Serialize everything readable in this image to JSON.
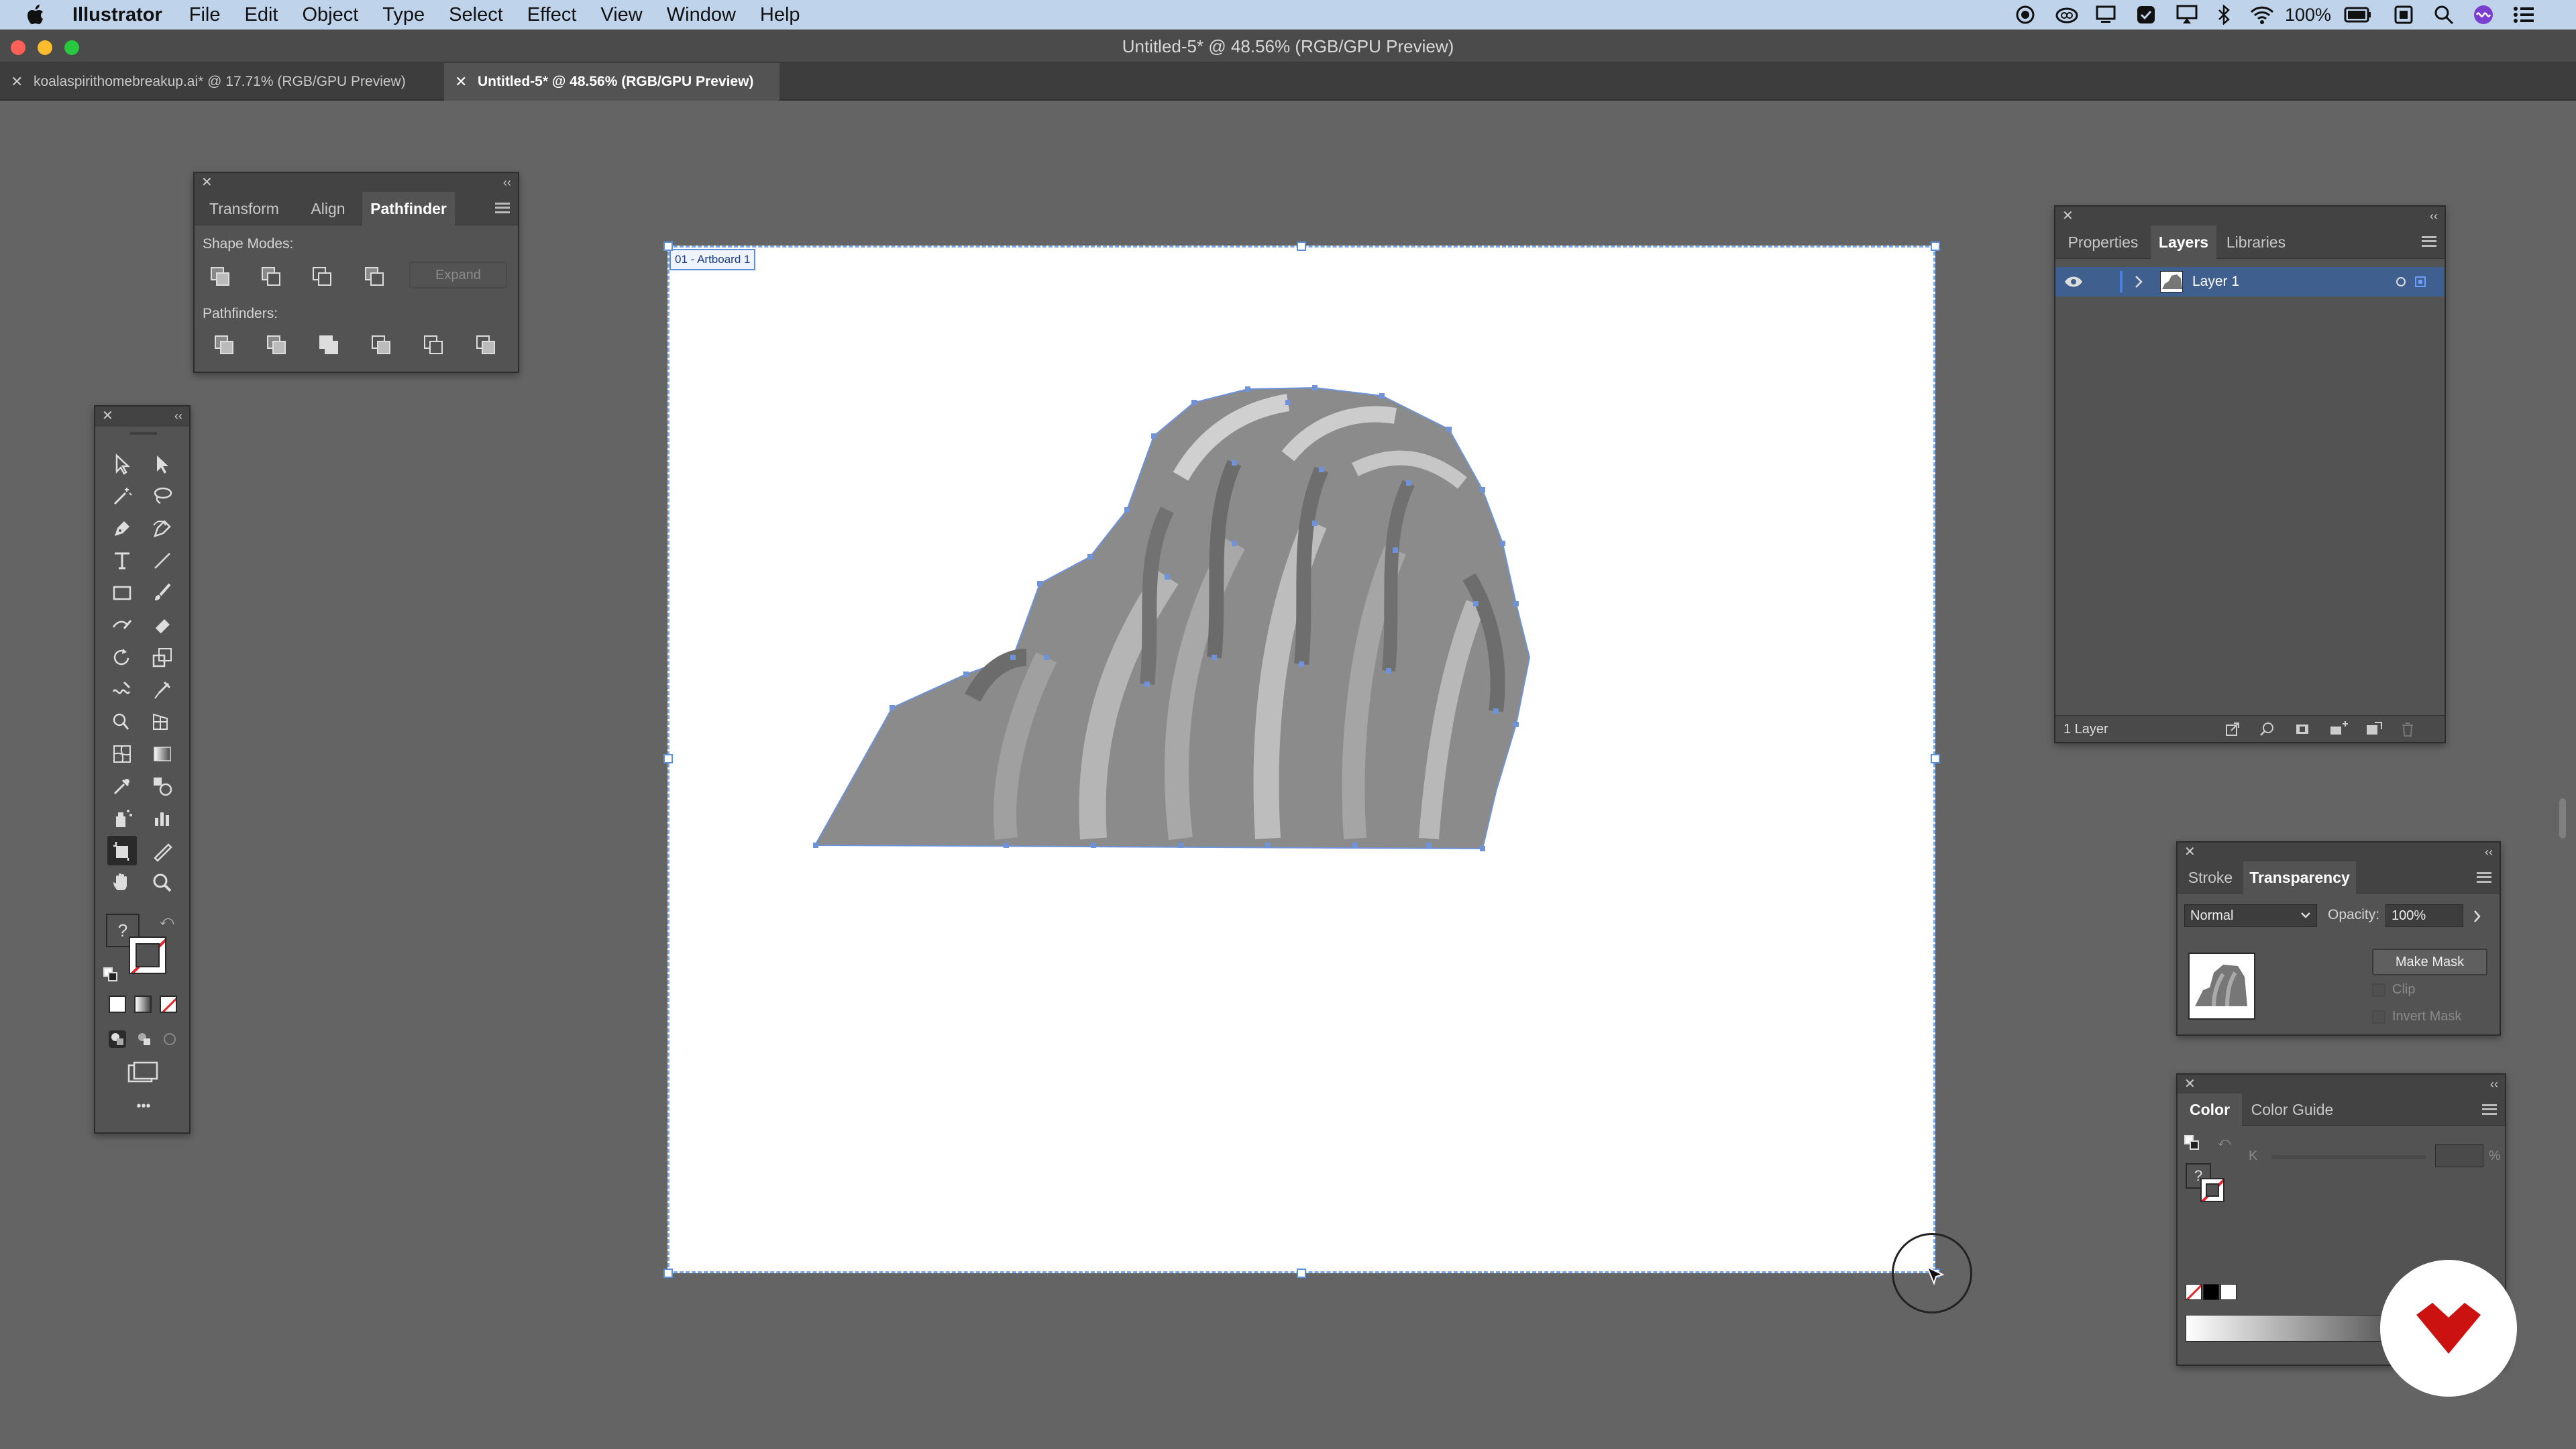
{
  "menubar": {
    "app": "Illustrator",
    "items": [
      "File",
      "Edit",
      "Object",
      "Type",
      "Select",
      "Effect",
      "View",
      "Window",
      "Help"
    ],
    "battery": "100%"
  },
  "window": {
    "title": "Untitled-5* @ 48.56% (RGB/GPU Preview)"
  },
  "doc_tabs": [
    {
      "label": "koalaspirithomebreakup.ai* @ 17.71% (RGB/GPU Preview)",
      "active": false
    },
    {
      "label": "Untitled-5* @ 48.56% (RGB/GPU Preview)",
      "active": true
    }
  ],
  "pathfinder_panel": {
    "tabs": [
      "Transform",
      "Align",
      "Pathfinder"
    ],
    "active_tab": "Pathfinder",
    "shape_modes_label": "Shape Modes:",
    "expand_label": "Expand",
    "pathfinders_label": "Pathfinders:"
  },
  "toolbar": {
    "fill_unknown": "?",
    "more_label": "•••",
    "selected_tool": "artboard-tool"
  },
  "artboard": {
    "label": "01 - Artboard 1"
  },
  "layers_panel": {
    "tabs": [
      "Properties",
      "Layers",
      "Libraries"
    ],
    "active_tab": "Layers",
    "layer_name": "Layer 1",
    "footer_count": "1 Layer"
  },
  "transparency_panel": {
    "tabs": [
      "Stroke",
      "Transparency"
    ],
    "active_tab": "Transparency",
    "blend_mode": "Normal",
    "opacity_label": "Opacity:",
    "opacity_value": "100%",
    "make_mask_label": "Make Mask",
    "clip_label": "Clip",
    "invert_mask_label": "Invert Mask"
  },
  "color_panel": {
    "tabs": [
      "Color",
      "Color Guide"
    ],
    "active_tab": "Color",
    "channel_label": "K",
    "percent_label": "%",
    "unknown_label": "?"
  },
  "colors": {
    "menubar": "#bfd3ea",
    "canvas": "#646464",
    "panel": "#535353",
    "selection": "#5c8fdc",
    "logo": "#cc1111"
  }
}
